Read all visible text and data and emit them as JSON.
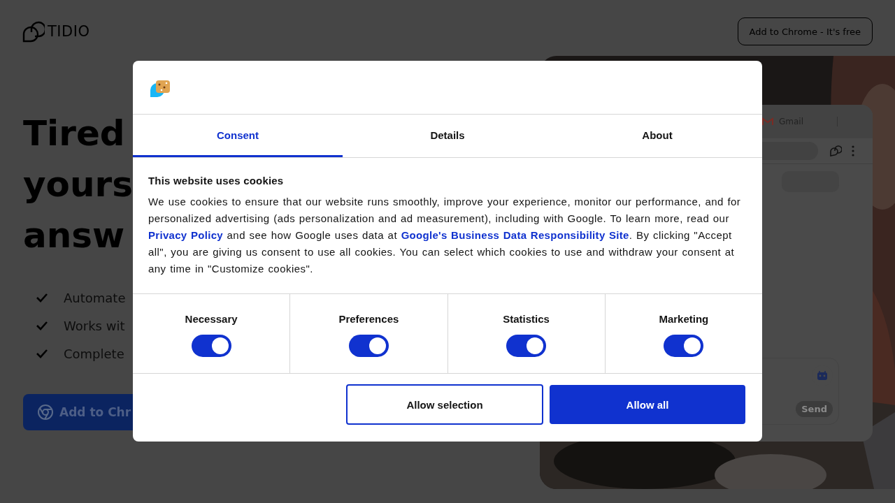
{
  "header": {
    "logo": "TIDIO",
    "cta": "Add to Chrome - It's free"
  },
  "hero": {
    "headline": [
      "Tired",
      "yours",
      "answ"
    ],
    "features": [
      "Automate",
      "Works wit",
      "Complete"
    ],
    "button": "Add to Chr"
  },
  "mockup": {
    "tab": "Gmail",
    "send": "Send"
  },
  "consent": {
    "tabs": [
      {
        "label": "Consent",
        "selected": true
      },
      {
        "label": "Details",
        "selected": false
      },
      {
        "label": "About",
        "selected": false
      }
    ],
    "title": "This website uses cookies",
    "text": "We use cookies to ensure that our website runs smoothly, improve your experience, monitor our performance, and for personalized advertising (ads personalization and ad measurement), including with Google. To learn more, read our",
    "link1": "Privacy Policy",
    "text2": "and see how Google uses data at",
    "link2": "Google's Business Data Responsibility Site",
    "text3": ". By clicking \"Accept all\", you are giving us consent to use all cookies. You can select which cookies to use and withdraw your consent at any time in \"Customize cookies\".",
    "categories": [
      {
        "label": "Necessary",
        "checked": true
      },
      {
        "label": "Preferences",
        "checked": true
      },
      {
        "label": "Statistics",
        "checked": true
      },
      {
        "label": "Marketing",
        "checked": true
      }
    ],
    "buttons": [
      {
        "label": "Allow selection",
        "kind": "outline"
      },
      {
        "label": "Allow all",
        "kind": "primary"
      }
    ]
  }
}
